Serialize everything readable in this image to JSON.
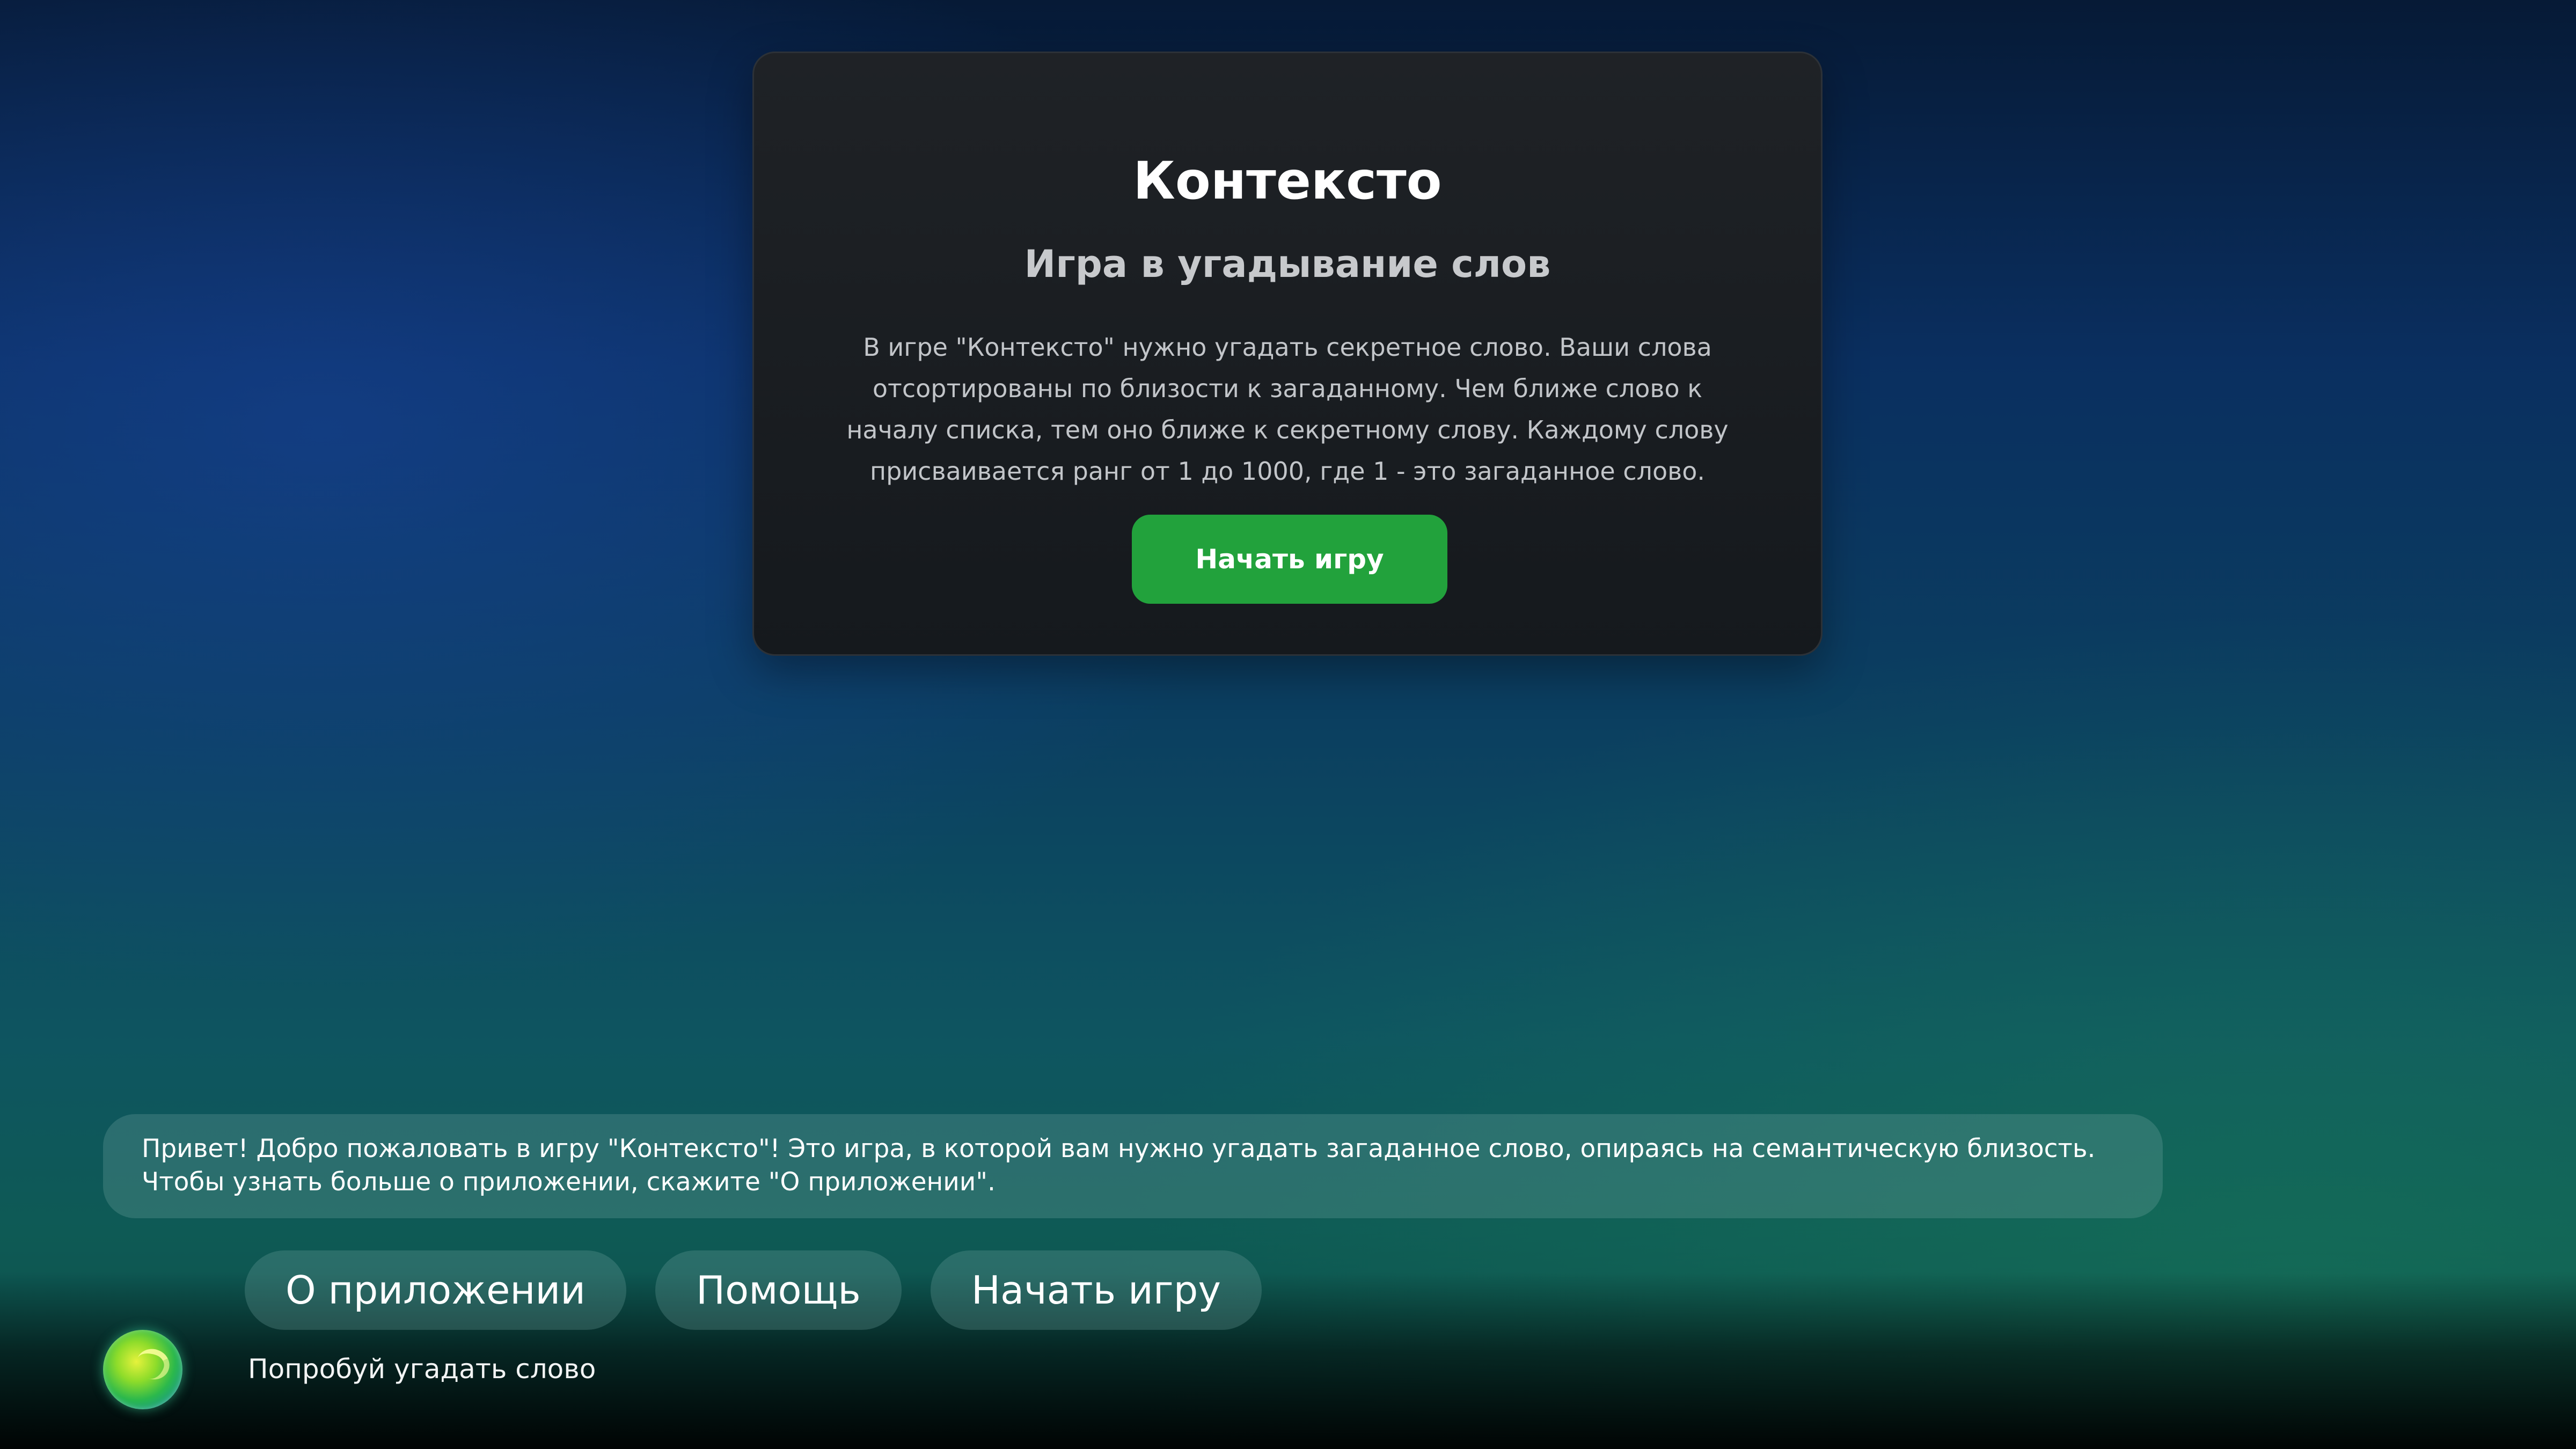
{
  "card": {
    "title": "Контексто",
    "subtitle": "Игра в угадывание слов",
    "description": "В игре \"Контексто\" нужно угадать секретное слово. Ваши слова отсортированы по близости к загаданному. Чем ближе слово к началу списка, тем оно ближе к секретному слову. Каждому слову присваивается ранг от 1 до 1000, где 1 - это загаданное слово.",
    "start_button": "Начать игру"
  },
  "assistant": {
    "message_line1": "Привет! Добро пожаловать в игру \"Контексто\"! Это игра, в которой вам нужно угадать загаданное слово, опираясь на семантическую близость.",
    "message_line2": "Чтобы узнать больше о приложении, скажите \"О приложении\".",
    "suggestions": [
      "О приложении",
      "Помощь",
      "Начать игру"
    ],
    "hint": "Попробуй угадать слово",
    "orb_icon": "assistant-orb-icon"
  },
  "colors": {
    "accent_green": "#22a23c",
    "card_background": "#1a1d21"
  }
}
